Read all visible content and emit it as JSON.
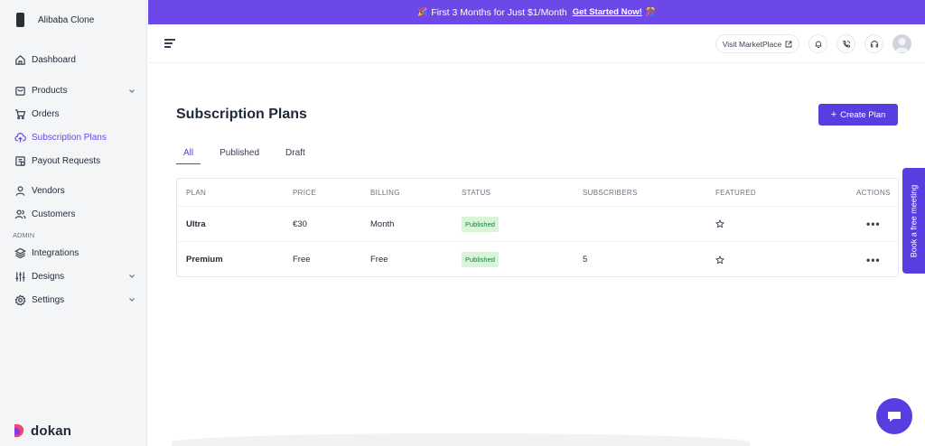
{
  "sidebar": {
    "store_name": "Alibaba Clone",
    "items": [
      {
        "label": "Dashboard",
        "icon": "home-icon"
      },
      {
        "label": "Products",
        "icon": "bag-icon",
        "has_chevron": true
      },
      {
        "label": "Orders",
        "icon": "cart-icon"
      },
      {
        "label": "Subscription Plans",
        "icon": "cloud-upload-icon",
        "active": true
      },
      {
        "label": "Payout Requests",
        "icon": "payout-icon"
      },
      {
        "label": "Vendors",
        "icon": "user-icon"
      },
      {
        "label": "Customers",
        "icon": "users-icon"
      }
    ],
    "admin_label": "ADMIN",
    "admin_items": [
      {
        "label": "Integrations",
        "icon": "layers-icon"
      },
      {
        "label": "Designs",
        "icon": "sliders-icon",
        "has_chevron": true
      },
      {
        "label": "Settings",
        "icon": "gear-icon",
        "has_chevron": true
      }
    ],
    "brand": "dokan"
  },
  "banner": {
    "text": "First 3 Months for Just $1/Month",
    "cta": "Get Started Now!",
    "color": "#6d48e8"
  },
  "header": {
    "visit_label": "Visit MarketPlace"
  },
  "main": {
    "title": "Subscription Plans",
    "create_label": "Create Plan",
    "tabs": [
      "All",
      "Published",
      "Draft"
    ],
    "active_tab": "All",
    "columns": [
      "PLAN",
      "PRICE",
      "BILLING",
      "STATUS",
      "SUBSCRIBERS",
      "FEATURED",
      "ACTIONS"
    ],
    "rows": [
      {
        "plan": "Ultra",
        "price": "€30",
        "billing": "Month",
        "status": "Published",
        "subscribers": ""
      },
      {
        "plan": "Premium",
        "price": "Free",
        "billing": "Free",
        "status": "Published",
        "subscribers": "5"
      }
    ]
  },
  "side_tab": "Book a free meeting",
  "accent": "#5a3de0"
}
